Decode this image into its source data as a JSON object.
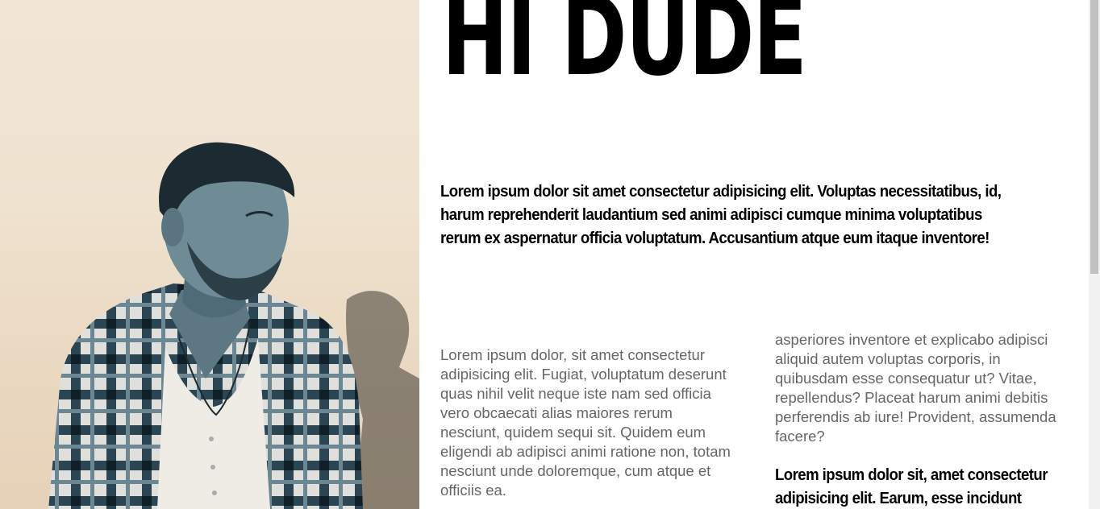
{
  "hero": {
    "title": "HI DUDE",
    "intro": "Lorem ipsum dolor sit amet consectetur adipisicing elit. Voluptas necessitatibus, id, harum reprehenderit laudantium sed animi adipisci cumque minima voluptatibus rerum ex aspernatur officia voluptatum. Accusantium atque eum itaque inventore!"
  },
  "columns": {
    "left_text": "Lorem ipsum dolor, sit amet consectetur adipisicing elit. Fugiat, voluptatum deserunt quas nihil velit neque iste nam sed officia vero obcaecati alias maiores rerum nesciunt, quidem sequi sit. Quidem eum eligendi ab adipisci animi ratione non, totam nesciunt unde doloremque, cum atque et officiis ea.",
    "right_text": "asperiores inventore et explicabo adipisci aliquid autem voluptas corporis, in quibusdam esse consequatur ut? Vitae, repellendus? Placeat harum animi debitis perferendis ab iure! Provident, assumenda facere?",
    "right_bold": "Lorem ipsum dolor sit, amet consectetur adipisicing elit. Earum, esse incidunt quod"
  },
  "colors": {
    "photo_background": "#efe2cf",
    "shirt_dark": "#1d3540",
    "shirt_light": "#e9e6dd",
    "text_muted": "#666666"
  }
}
